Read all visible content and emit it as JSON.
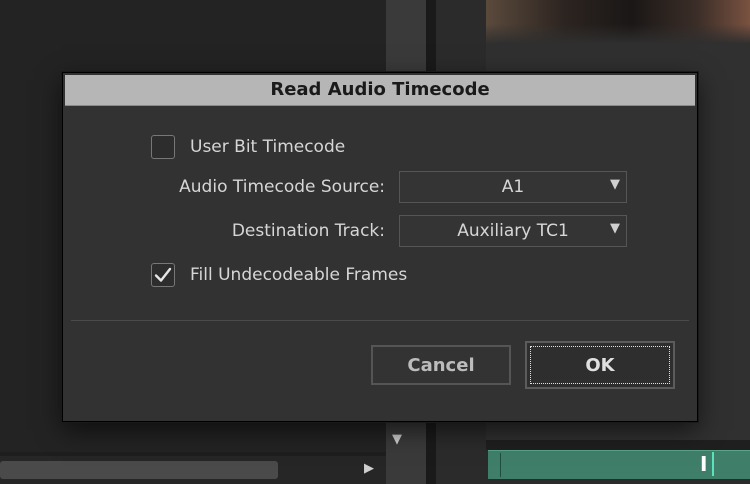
{
  "dialog": {
    "title": "Read Audio Timecode",
    "user_bit_timecode": {
      "label": "User Bit Timecode",
      "checked": false
    },
    "audio_timecode_source": {
      "label": "Audio Timecode Source:",
      "value": "A1"
    },
    "destination_track": {
      "label": "Destination Track:",
      "value": "Auxiliary TC1"
    },
    "fill_undecodeable_frames": {
      "label": "Fill Undecodeable Frames",
      "checked": true
    },
    "cancel_label": "Cancel",
    "ok_label": "OK"
  },
  "icons": {
    "dropdown": "chevron-down-icon",
    "scroll_down": "triangle-down-icon",
    "scroll_right": "triangle-right-icon",
    "checkmark": "checkmark-icon"
  },
  "colors": {
    "timeline_track": "#3f7f6a",
    "playhead": "#5be0c0",
    "dialog_title_bar": "#b6b6b6"
  }
}
